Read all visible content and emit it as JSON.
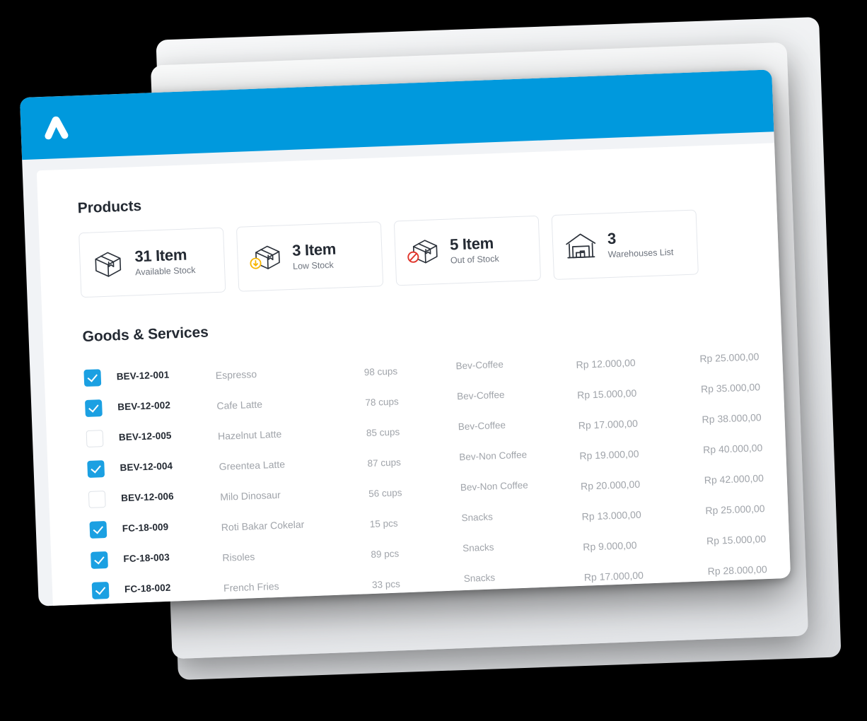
{
  "app": {
    "logo_name": "chevron-logo",
    "accent_color": "#0099DD",
    "checkbox_color": "#1BA0E2"
  },
  "products_section": {
    "title": "Products",
    "cards": [
      {
        "value": "31 Item",
        "label": "Available Stock",
        "icon": "box-icon",
        "badge": "none",
        "badge_color": ""
      },
      {
        "value": "3 Item",
        "label": "Low Stock",
        "icon": "box-low-stock-icon",
        "badge": "arrow-down-circle",
        "badge_color": "#F7B500"
      },
      {
        "value": "5 Item",
        "label": "Out of Stock",
        "icon": "box-out-of-stock-icon",
        "badge": "prohibited-circle",
        "badge_color": "#E0352B"
      },
      {
        "value": "3",
        "label": "Warehouses List",
        "icon": "warehouse-icon",
        "badge": "none",
        "badge_color": ""
      }
    ]
  },
  "goods_section": {
    "title": "Goods & Services",
    "rows": [
      {
        "checked": true,
        "code": "BEV-12-001",
        "name": "Espresso",
        "qty": "98 cups",
        "category": "Bev-Coffee",
        "cost": "Rp 12.000,00",
        "price": "Rp 25.000,00"
      },
      {
        "checked": true,
        "code": "BEV-12-002",
        "name": "Cafe Latte",
        "qty": "78 cups",
        "category": "Bev-Coffee",
        "cost": "Rp 15.000,00",
        "price": "Rp 35.000,00"
      },
      {
        "checked": false,
        "code": "BEV-12-005",
        "name": "Hazelnut Latte",
        "qty": "85 cups",
        "category": "Bev-Coffee",
        "cost": "Rp 17.000,00",
        "price": "Rp 38.000,00"
      },
      {
        "checked": true,
        "code": "BEV-12-004",
        "name": "Greentea Latte",
        "qty": "87 cups",
        "category": "Bev-Non Coffee",
        "cost": "Rp 19.000,00",
        "price": "Rp 40.000,00"
      },
      {
        "checked": false,
        "code": "BEV-12-006",
        "name": "Milo Dinosaur",
        "qty": "56 cups",
        "category": "Bev-Non Coffee",
        "cost": "Rp 20.000,00",
        "price": "Rp 42.000,00"
      },
      {
        "checked": true,
        "code": "FC-18-009",
        "name": "Roti Bakar Cokelar",
        "qty": "15 pcs",
        "category": "Snacks",
        "cost": "Rp 13.000,00",
        "price": "Rp 25.000,00"
      },
      {
        "checked": true,
        "code": "FC-18-003",
        "name": "Risoles",
        "qty": "89 pcs",
        "category": "Snacks",
        "cost": "Rp 9.000,00",
        "price": "Rp 15.000,00"
      },
      {
        "checked": true,
        "code": "FC-18-002",
        "name": "French Fries",
        "qty": "33 pcs",
        "category": "Snacks",
        "cost": "Rp 17.000,00",
        "price": "Rp 28.000,00"
      }
    ]
  }
}
